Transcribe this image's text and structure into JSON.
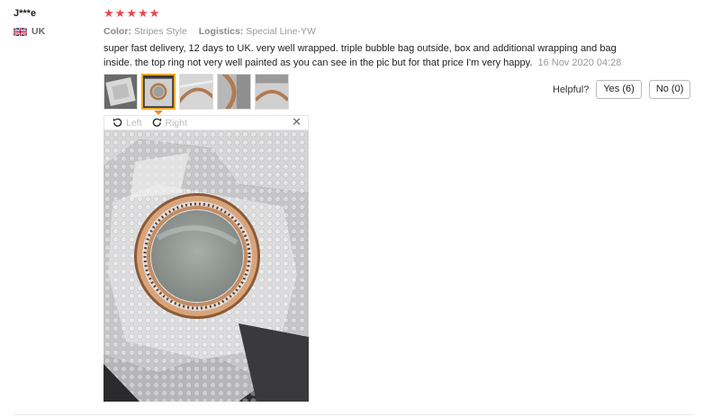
{
  "review": {
    "user_name": "J***e",
    "country": "UK",
    "rating": 5,
    "stars": [
      "★",
      "★",
      "★",
      "★",
      "★"
    ],
    "color_label": "Color:",
    "color_value": "Stripes Style",
    "logistics_label": "Logistics:",
    "logistics_value": "Special Line-YW",
    "text": "super fast delivery, 12 days to UK. very well wrapped. triple bubble bag outside, box and additional wrapping and bag inside. the top ring not very well painted as you can see in the pic but for that price I'm very happy.",
    "date": "16 Nov 2020 04:28"
  },
  "helpful": {
    "label": "Helpful?",
    "yes_label": "Yes (6)",
    "no_label": "No (0)"
  },
  "viewer": {
    "left_label": "Left",
    "right_label": "Right",
    "close_glyph": "✕",
    "active_thumb_index": 1
  },
  "colors": {
    "star": "#e8474c",
    "active_thumb_border": "#f0a832",
    "muted_text": "#999999"
  }
}
